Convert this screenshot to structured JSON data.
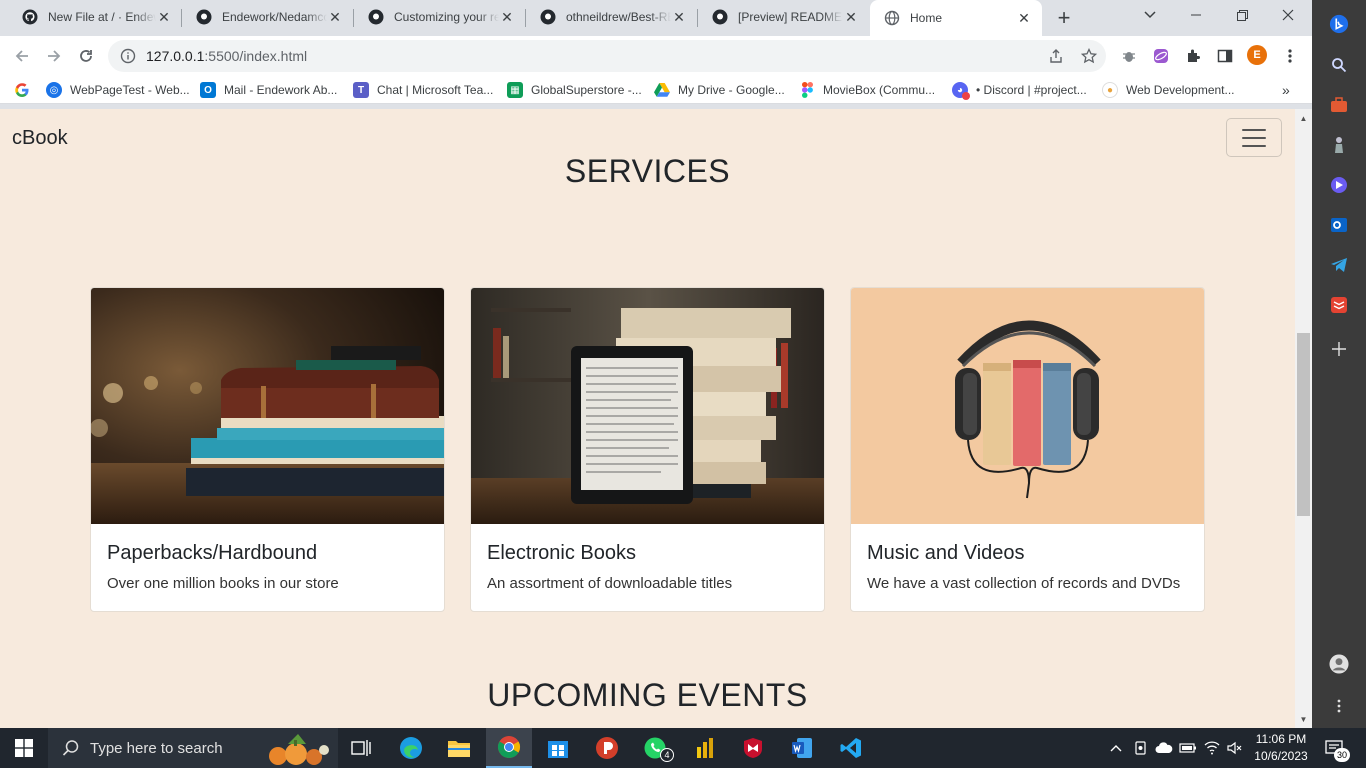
{
  "browser": {
    "tabs": [
      {
        "title": "New File at / · Endework",
        "active": false
      },
      {
        "title": "Endework/Nedamco",
        "active": false
      },
      {
        "title": "Customizing your repository",
        "active": false
      },
      {
        "title": "othneildrew/Best-README",
        "active": false
      },
      {
        "title": "[Preview] README.md",
        "active": false
      },
      {
        "title": "Home",
        "active": true
      }
    ],
    "url_host": "127.0.0.1",
    "url_path": ":5500/index.html",
    "profile_initial": "E"
  },
  "bookmarks": [
    {
      "label": "WebPageTest - Web...",
      "icon": "webpagetest-icon",
      "color": "#1a73e8"
    },
    {
      "label": "Mail - Endework Ab...",
      "icon": "outlook-icon",
      "color": "#0078d4"
    },
    {
      "label": "Chat | Microsoft Tea...",
      "icon": "teams-icon",
      "color": "#5b5fc7"
    },
    {
      "label": "GlobalSuperstore -...",
      "icon": "sheets-icon",
      "color": "#0f9d58"
    },
    {
      "label": "My Drive - Google...",
      "icon": "drive-icon",
      "color": "#fbbc04"
    },
    {
      "label": "MovieBox (Commu...",
      "icon": "figma-icon",
      "color": "#f24e1e"
    },
    {
      "label": "• Discord | #project...",
      "icon": "discord-icon",
      "color": "#5865f2"
    },
    {
      "label": "Web Development...",
      "icon": "bookmark-icon",
      "color": "#e8a33d"
    }
  ],
  "page": {
    "brand": "cBook",
    "services_title": "SERVICES",
    "events_title": "UPCOMING EVENTS",
    "cards": [
      {
        "title": "Paperbacks/Hardbound",
        "text": "Over one million books in our store"
      },
      {
        "title": "Electronic Books",
        "text": "An assortment of downloadable titles"
      },
      {
        "title": "Music and Videos",
        "text": "We have a vast collection of records and DVDs"
      }
    ]
  },
  "taskbar": {
    "search_placeholder": "Type here to search",
    "time": "11:06 PM",
    "date": "10/6/2023",
    "whatsapp_badge": "4",
    "notifications": "30"
  }
}
